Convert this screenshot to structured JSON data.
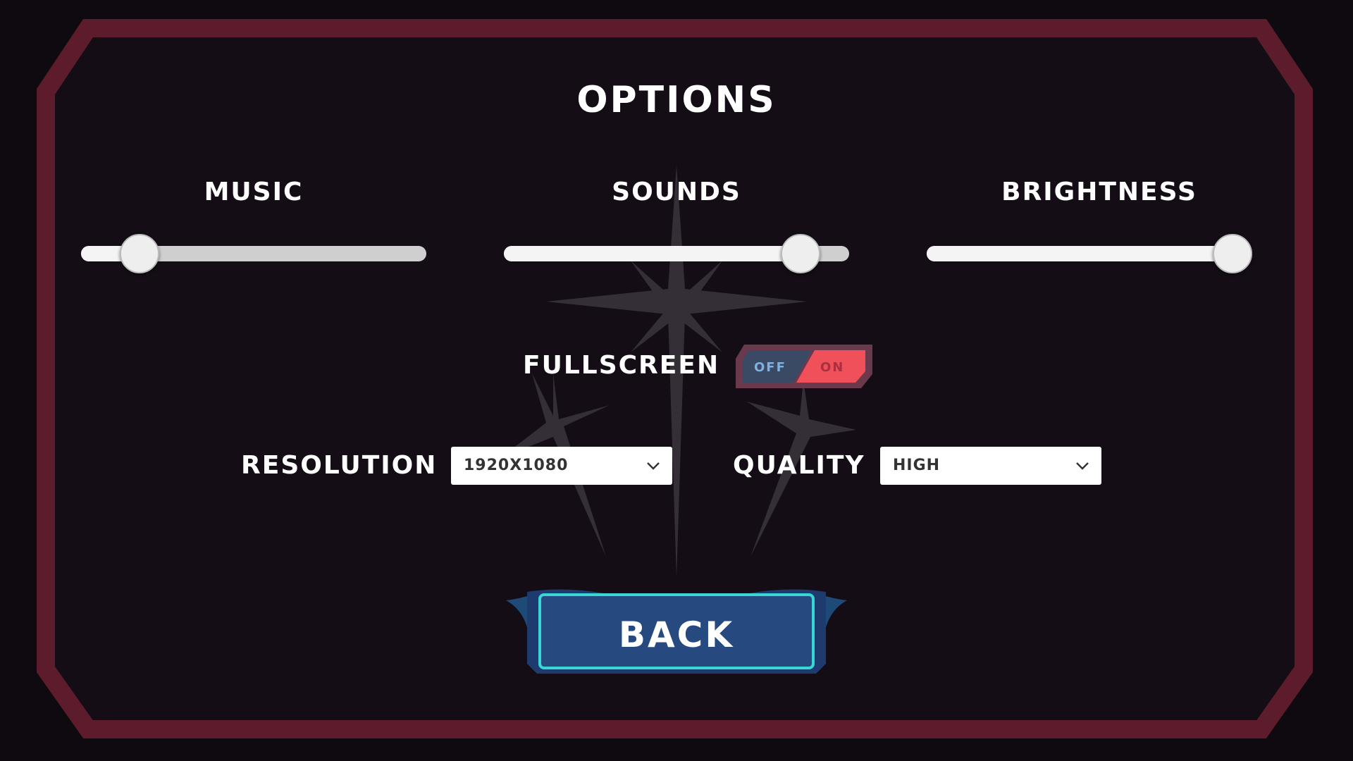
{
  "screen": {
    "title": "OPTIONS",
    "frame_color": "#5c1c2c",
    "background_color": "#120c14"
  },
  "sliders": [
    {
      "label": "MUSIC",
      "value": 0.17
    },
    {
      "label": "SOUNDS",
      "value": 0.86
    },
    {
      "label": "BRIGHTNESS",
      "value": 1.0
    }
  ],
  "fullscreen": {
    "label": "FULLSCREEN",
    "off_text": "OFF",
    "on_text": "ON",
    "state": "ON",
    "on_color": "#f0505a",
    "off_color": "#3a4a64"
  },
  "resolution": {
    "label": "RESOLUTION",
    "selected": "1920X1080",
    "icon": "chevron-down-icon"
  },
  "quality": {
    "label": "QUALITY",
    "selected": "HIGH",
    "icon": "chevron-down-icon"
  },
  "back_button": {
    "label": "BACK",
    "fill_color": "#264a80",
    "border_color": "#3ad6d6"
  }
}
